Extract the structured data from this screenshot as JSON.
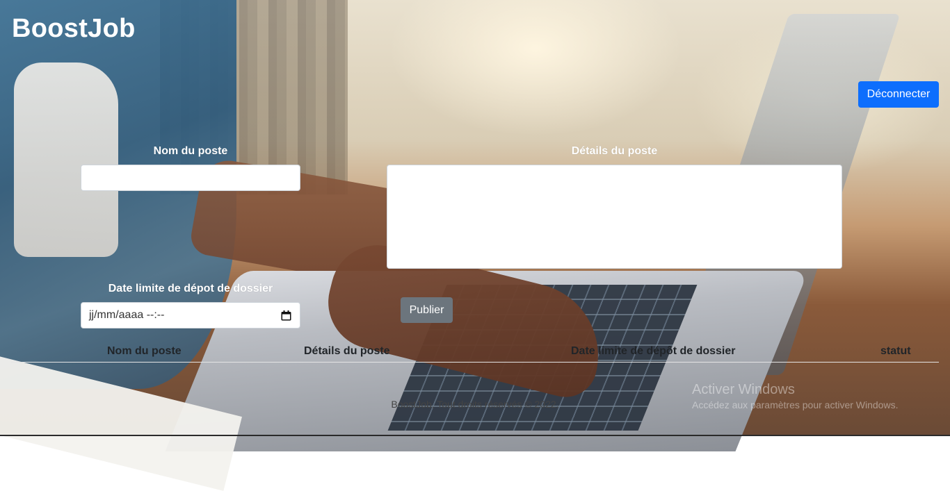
{
  "header": {
    "brand": "BoostJob",
    "logout_label": "Déconnecter"
  },
  "form": {
    "job_name_label": "Nom du poste",
    "job_name_value": "",
    "job_details_label": "Détails du poste",
    "job_details_value": "",
    "deadline_label": "Date limite de dépot de dossier",
    "deadline_placeholder": "jj/mm/aaaa --:--",
    "publish_label": "Publier"
  },
  "table": {
    "columns": [
      "Nom du poste",
      "Détails du poste",
      "Date limite de dépôt de dossier",
      "statut"
    ]
  },
  "footer": {
    "text": "BoostJob, Tout droits réservés © 2022."
  },
  "watermark": {
    "title": "Activer Windows",
    "subtitle": "Accédez aux paramètres pour activer Windows."
  },
  "colors": {
    "primary": "#0d6efd",
    "secondary": "#6c757d"
  }
}
